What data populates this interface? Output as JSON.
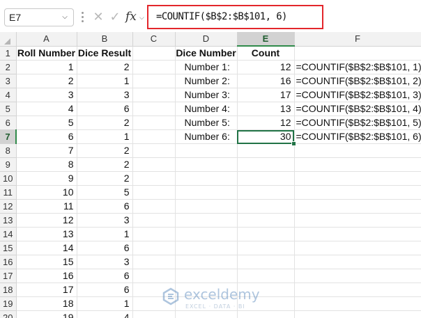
{
  "formula_bar": {
    "name_box": "E7",
    "fx_label": "fx",
    "formula": "=COUNTIF($B$2:$B$101, 6)"
  },
  "columns": [
    "A",
    "B",
    "C",
    "D",
    "E",
    "F"
  ],
  "rows": [
    {
      "n": "1",
      "A": "Roll Number",
      "B": "Dice Result",
      "C": "",
      "D": "Dice Number",
      "E": "Count",
      "F": ""
    },
    {
      "n": "2",
      "A": "1",
      "B": "2",
      "C": "",
      "D": "Number 1:",
      "E": "12",
      "F": "=COUNTIF($B$2:$B$101, 1)"
    },
    {
      "n": "3",
      "A": "2",
      "B": "1",
      "C": "",
      "D": "Number 2:",
      "E": "16",
      "F": "=COUNTIF($B$2:$B$101, 2)"
    },
    {
      "n": "4",
      "A": "3",
      "B": "3",
      "C": "",
      "D": "Number 3:",
      "E": "17",
      "F": "=COUNTIF($B$2:$B$101, 3)"
    },
    {
      "n": "5",
      "A": "4",
      "B": "6",
      "C": "",
      "D": "Number 4:",
      "E": "13",
      "F": "=COUNTIF($B$2:$B$101, 4)"
    },
    {
      "n": "6",
      "A": "5",
      "B": "2",
      "C": "",
      "D": "Number 5:",
      "E": "12",
      "F": "=COUNTIF($B$2:$B$101, 5)"
    },
    {
      "n": "7",
      "A": "6",
      "B": "1",
      "C": "",
      "D": "Number 6:",
      "E": "30",
      "F": "=COUNTIF($B$2:$B$101, 6)"
    },
    {
      "n": "8",
      "A": "7",
      "B": "2",
      "C": "",
      "D": "",
      "E": "",
      "F": ""
    },
    {
      "n": "9",
      "A": "8",
      "B": "2",
      "C": "",
      "D": "",
      "E": "",
      "F": ""
    },
    {
      "n": "10",
      "A": "9",
      "B": "2",
      "C": "",
      "D": "",
      "E": "",
      "F": ""
    },
    {
      "n": "11",
      "A": "10",
      "B": "5",
      "C": "",
      "D": "",
      "E": "",
      "F": ""
    },
    {
      "n": "12",
      "A": "11",
      "B": "6",
      "C": "",
      "D": "",
      "E": "",
      "F": ""
    },
    {
      "n": "13",
      "A": "12",
      "B": "3",
      "C": "",
      "D": "",
      "E": "",
      "F": ""
    },
    {
      "n": "14",
      "A": "13",
      "B": "1",
      "C": "",
      "D": "",
      "E": "",
      "F": ""
    },
    {
      "n": "15",
      "A": "14",
      "B": "6",
      "C": "",
      "D": "",
      "E": "",
      "F": ""
    },
    {
      "n": "16",
      "A": "15",
      "B": "3",
      "C": "",
      "D": "",
      "E": "",
      "F": ""
    },
    {
      "n": "17",
      "A": "16",
      "B": "6",
      "C": "",
      "D": "",
      "E": "",
      "F": ""
    },
    {
      "n": "18",
      "A": "17",
      "B": "6",
      "C": "",
      "D": "",
      "E": "",
      "F": ""
    },
    {
      "n": "19",
      "A": "18",
      "B": "1",
      "C": "",
      "D": "",
      "E": "",
      "F": ""
    },
    {
      "n": "20",
      "A": "19",
      "B": "4",
      "C": "",
      "D": "",
      "E": "",
      "F": ""
    }
  ],
  "active_cell": {
    "row": "7",
    "col": "E"
  },
  "watermark": {
    "name": "exceldemy",
    "tagline": "EXCEL · DATA · BI"
  },
  "colors": {
    "highlight_border": "#e3262b",
    "selection_green": "#217346"
  },
  "icons": {
    "cancel": "close-icon",
    "enter": "check-icon",
    "name_box_dropdown": "chevron-down-icon"
  }
}
